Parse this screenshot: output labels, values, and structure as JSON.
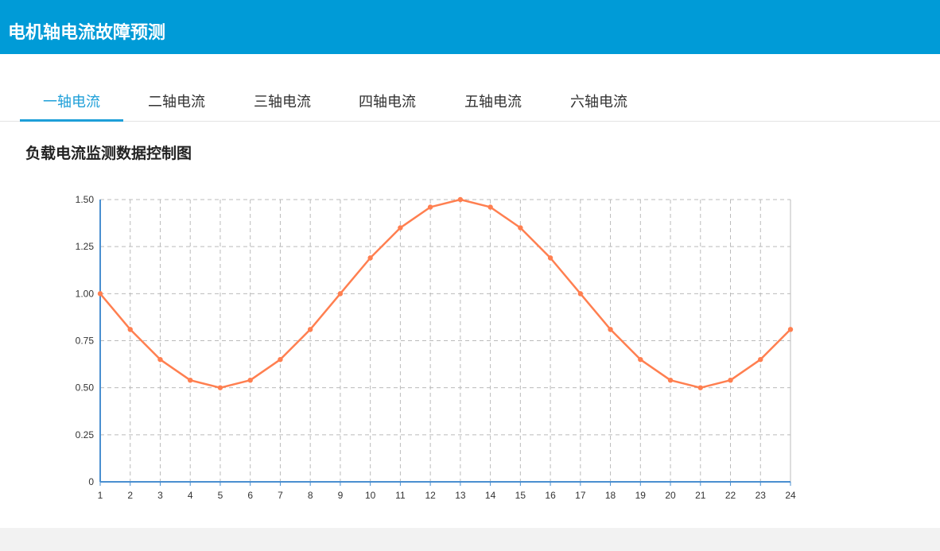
{
  "header": {
    "title": "电机轴电流故障预测"
  },
  "tabs": [
    {
      "label": "一轴电流",
      "active": true
    },
    {
      "label": "二轴电流",
      "active": false
    },
    {
      "label": "三轴电流",
      "active": false
    },
    {
      "label": "四轴电流",
      "active": false
    },
    {
      "label": "五轴电流",
      "active": false
    },
    {
      "label": "六轴电流",
      "active": false
    }
  ],
  "section": {
    "title": "负载电流监测数据控制图"
  },
  "colors": {
    "header_bg": "#009bd7",
    "tab_active": "#1e9fd8",
    "series_line": "#ff7f50",
    "axis_line": "#4a8fd0",
    "grid": "#bbbbbb"
  },
  "chart_data": {
    "type": "line",
    "title": "",
    "xlabel": "",
    "ylabel": "",
    "x": [
      1,
      2,
      3,
      4,
      5,
      6,
      7,
      8,
      9,
      10,
      11,
      12,
      13,
      14,
      15,
      16,
      17,
      18,
      19,
      20,
      21,
      22,
      23,
      24
    ],
    "series": [
      {
        "values": [
          1.0,
          0.81,
          0.65,
          0.54,
          0.5,
          0.54,
          0.65,
          0.81,
          1.0,
          1.19,
          1.35,
          1.46,
          1.5,
          1.46,
          1.35,
          1.19,
          1.0,
          0.81,
          0.65,
          0.54,
          0.5,
          0.54,
          0.65,
          0.81
        ]
      }
    ],
    "ylim": [
      0,
      1.5
    ],
    "yticks": [
      "0",
      "0.25",
      "0.50",
      "0.75",
      "1.00",
      "1.25",
      "1.50"
    ],
    "xticks": [
      "1",
      "2",
      "3",
      "4",
      "5",
      "6",
      "7",
      "8",
      "9",
      "10",
      "11",
      "12",
      "13",
      "14",
      "15",
      "16",
      "17",
      "18",
      "19",
      "20",
      "21",
      "22",
      "23",
      "24"
    ],
    "grid": true,
    "legend": "none"
  }
}
